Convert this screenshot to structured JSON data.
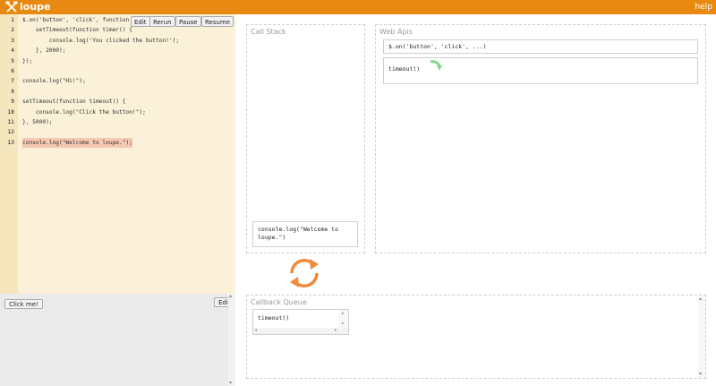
{
  "app": {
    "title": "loupe",
    "help": "help"
  },
  "toolbar": {
    "edit": "Edit",
    "rerun": "Rerun",
    "pause": "Pause",
    "resume": "Resume"
  },
  "code": [
    {
      "num": "1",
      "text": "$.on('button', 'click', function onClick() {"
    },
    {
      "num": "2",
      "text": "    setTimeout(function timer() {"
    },
    {
      "num": "3",
      "text": "        console.log('You clicked the button!');"
    },
    {
      "num": "4",
      "text": "    }, 2000);"
    },
    {
      "num": "5",
      "text": "});"
    },
    {
      "num": "6",
      "text": ""
    },
    {
      "num": "7",
      "text": "console.log(\"Hi!\");"
    },
    {
      "num": "8",
      "text": ""
    },
    {
      "num": "9",
      "text": "setTimeout(function timeout() {"
    },
    {
      "num": "10",
      "text": "    console.log(\"Click the button!\");"
    },
    {
      "num": "11",
      "text": "}, 5000);"
    },
    {
      "num": "12",
      "text": ""
    },
    {
      "num": "13",
      "text": "console.log(\"Welcome to loupe.\");"
    }
  ],
  "preview": {
    "click_me": "Click me!",
    "edit": "Edit"
  },
  "call_stack": {
    "title": "Call Stack",
    "frame": "console.log(\"Welcome to loupe.\")"
  },
  "web_apis": {
    "title": "Web Apis",
    "items": [
      "$.on('button', 'click', ...)",
      "timeout()"
    ]
  },
  "callback_queue": {
    "title": "Callback Queue",
    "items": [
      "timeout()"
    ]
  },
  "colors": {
    "accent": "#e88a12",
    "refresh": "#f08a3c",
    "arrow": "#7fd98a",
    "highlight": "#f5c8b2"
  }
}
